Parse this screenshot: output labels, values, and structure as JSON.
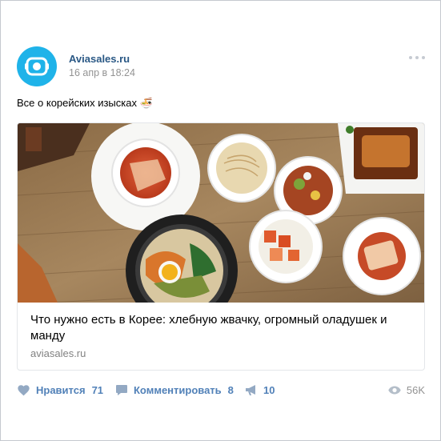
{
  "post": {
    "author": "Aviasales.ru",
    "date": "16 апр в 18:24",
    "text": "Все о корейских изысках 🍜"
  },
  "link": {
    "title": "Что нужно есть в Корее: хлебную жвачку, огромный оладушек и манду",
    "domain": "aviasales.ru"
  },
  "actions": {
    "like_label": "Нравится",
    "like_count": "71",
    "comment_label": "Комментировать",
    "comment_count": "8",
    "share_count": "10",
    "views_count": "56K"
  },
  "icons": {
    "avatar": "aviasales-logo-icon",
    "more": "more-dots-icon",
    "like": "heart-icon",
    "comment": "comment-bubble-icon",
    "share": "megaphone-icon",
    "views": "eye-icon"
  },
  "colors": {
    "link_blue": "#2a5885",
    "action_blue": "#5181b8",
    "avatar_blue": "#1fb3e9",
    "meta_gray": "#939393"
  }
}
